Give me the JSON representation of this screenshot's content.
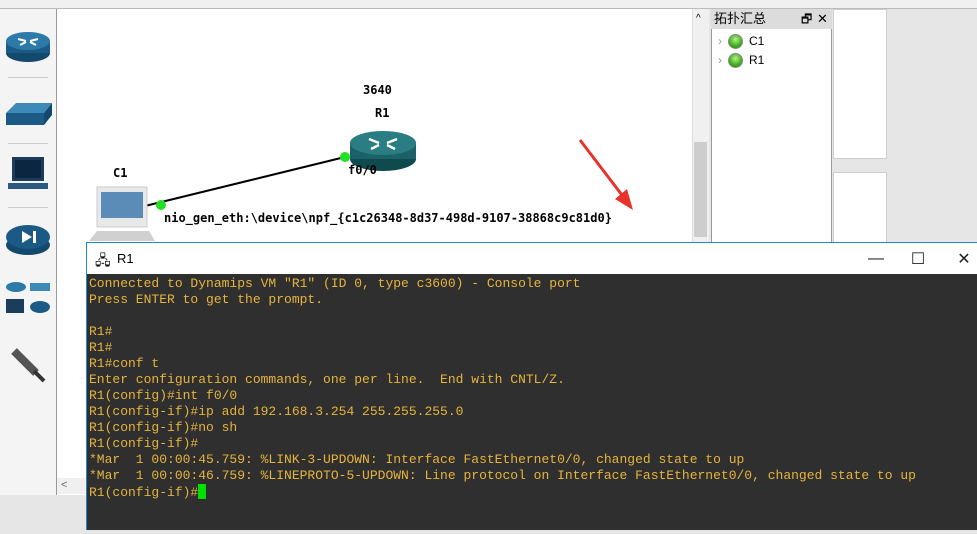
{
  "topology": {
    "title": "拓扑汇总",
    "nodes": [
      {
        "name": "C1"
      },
      {
        "name": "R1"
      }
    ]
  },
  "canvas": {
    "router_model": "3640",
    "router_name": "R1",
    "pc_name": "C1",
    "router_port": "f0/0",
    "pc_port": "nio_gen_eth:\\device\\npf_{c1c26348-8d37-498d-9107-38868c9c81d0}"
  },
  "terminal": {
    "title": "R1",
    "lines": [
      "Connected to Dynamips VM \"R1\" (ID 0, type c3600) - Console port",
      "Press ENTER to get the prompt.",
      "",
      "R1#",
      "R1#",
      "R1#conf t",
      "Enter configuration commands, one per line.  End with CNTL/Z.",
      "R1(config)#int f0/0",
      "R1(config-if)#ip add 192.168.3.254 255.255.255.0",
      "R1(config-if)#no sh",
      "R1(config-if)#",
      "*Mar  1 00:00:45.759: %LINK-3-UPDOWN: Interface FastEthernet0/0, changed state to up",
      "*Mar  1 00:00:46.759: %LINEPROTO-5-UPDOWN: Line protocol on Interface FastEthernet0/0, changed state to up"
    ],
    "prompt": "R1(config-if)#"
  },
  "colors": {
    "terminal_text": "#e6b43c",
    "cursor": "#00e000",
    "annotation_arrow": "#e8322a"
  }
}
